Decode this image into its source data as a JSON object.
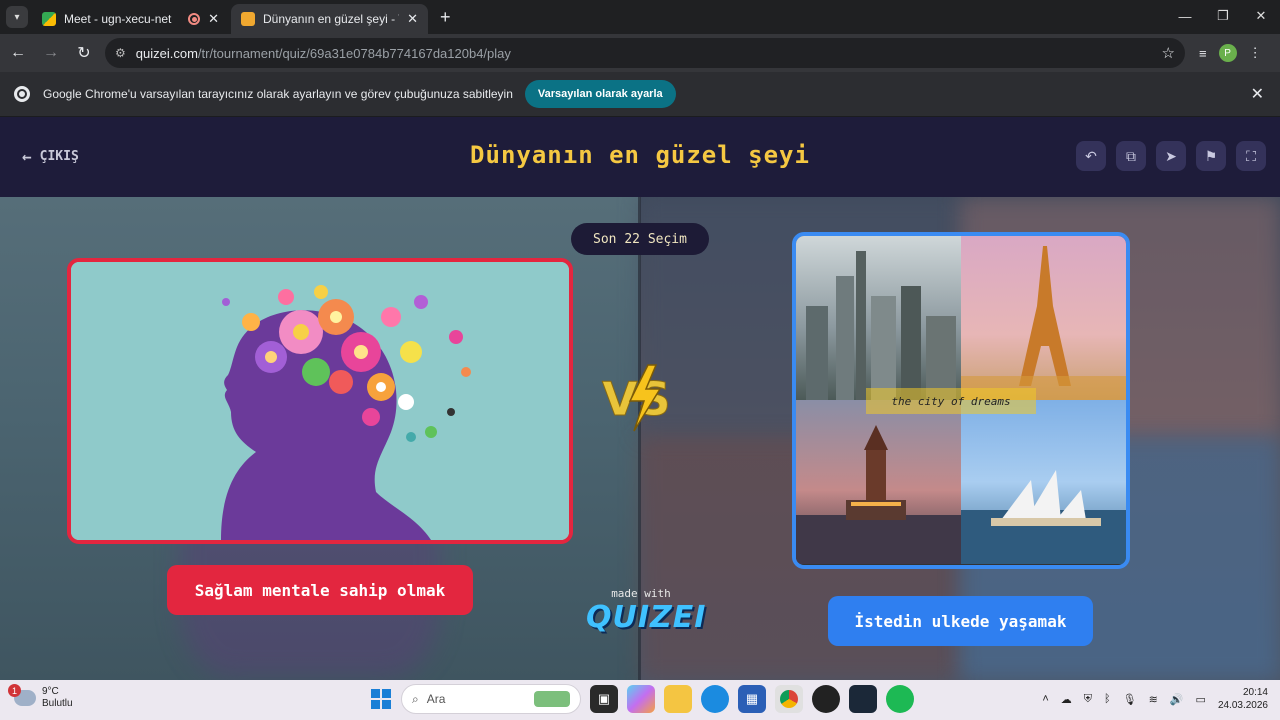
{
  "browser": {
    "tabs": [
      {
        "title": "Meet - ugn-xecu-net",
        "active": false,
        "recording": true
      },
      {
        "title": "Dünyanın en güzel şeyi - Tier Li",
        "active": true,
        "recording": false
      }
    ],
    "url_host": "quizei.com",
    "url_path": "/tr/tournament/quiz/69a31e0784b774167da120b4/play",
    "profile_initial": "P"
  },
  "infobar": {
    "message": "Google Chrome'u varsayılan tarayıcınız olarak ayarlayın ve görev çubuğunuza sabitleyin",
    "button": "Varsayılan olarak ayarla"
  },
  "header": {
    "exit_label": "ÇIKIŞ",
    "title": "Dünyanın en güzel şeyi",
    "icons": [
      "undo-icon",
      "share-icon",
      "send-icon",
      "flag-icon",
      "fullscreen-icon"
    ]
  },
  "match": {
    "round_badge": "Son 22 Seçim",
    "left_caption": "Sağlam mentale sahip olmak",
    "right_caption": "İstedin ulkede yaşamak",
    "right_image_text": "the city of dreams",
    "vs_text": "VS"
  },
  "branding": {
    "made_with": "made with",
    "logo": "QUIZEI"
  },
  "taskbar": {
    "weather_temp": "9°C",
    "weather_desc": "Bulutlu",
    "weather_badge": "1",
    "search_placeholder": "Ara",
    "time": "20:14",
    "date": "24.03.2026"
  },
  "colors": {
    "title_yellow": "#f5c842",
    "left_accent": "#e3263f",
    "right_accent": "#2f7ff0"
  }
}
